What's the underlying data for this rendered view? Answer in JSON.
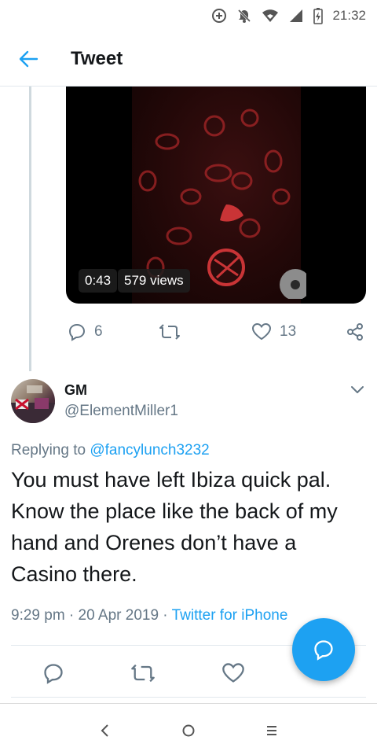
{
  "status_bar": {
    "time": "21:32",
    "icons": [
      "data-saver-icon",
      "notifications-off-icon",
      "wifi-icon",
      "signal-icon",
      "battery-charging-icon"
    ]
  },
  "header": {
    "title": "Tweet",
    "back_icon": "arrow-left-icon"
  },
  "media": {
    "duration": "0:43",
    "views": "579 views"
  },
  "original_actions": {
    "reply_count": "6",
    "retweet_count": "",
    "like_count": "13"
  },
  "reply_tweet": {
    "display_name": "GM",
    "handle": "@ElementMiller1",
    "replying_prefix": "Replying to ",
    "replying_to": "@fancylunch3232",
    "text": "You must have left Ibiza quick pal. Know the place like the back of my hand and Orenes don’t have a Casino there.",
    "time": "9:29 pm",
    "date": "20 Apr 2019",
    "source": "Twitter for iPhone",
    "separator": " · "
  },
  "colors": {
    "accent": "#1da1f2",
    "muted": "#657786",
    "text": "#14171a"
  },
  "nav_bar": {
    "back": "<",
    "home": "○",
    "recents": "≡"
  }
}
